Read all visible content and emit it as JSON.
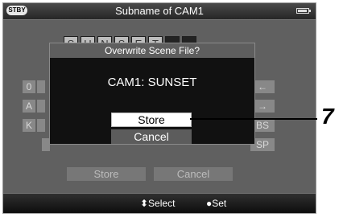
{
  "status": {
    "mode_badge": "STBY",
    "battery_icon": "battery-icon"
  },
  "title": "Subname of CAM1",
  "name_entry": [
    "S",
    "U",
    "N",
    "S",
    "E",
    "T",
    "",
    ""
  ],
  "keyboard_visible": {
    "left_keys": [
      "0",
      "A",
      "K"
    ],
    "right_keys": [
      "←",
      "→",
      "BS",
      "SP"
    ]
  },
  "background_buttons": {
    "store": "Store",
    "cancel": "Cancel"
  },
  "dialog": {
    "title": "Overwrite Scene File?",
    "message": "CAM1: SUNSET",
    "store_label": "Store",
    "cancel_label": "Cancel"
  },
  "hints": {
    "select": "⬍Select",
    "set": "●Set"
  },
  "callout": {
    "number": "7"
  },
  "colors": {
    "screen_bg": "#050505",
    "dim_overlay": "#606060",
    "selected_button": "#ffffff",
    "dialog_header": "#5e5e5e"
  }
}
